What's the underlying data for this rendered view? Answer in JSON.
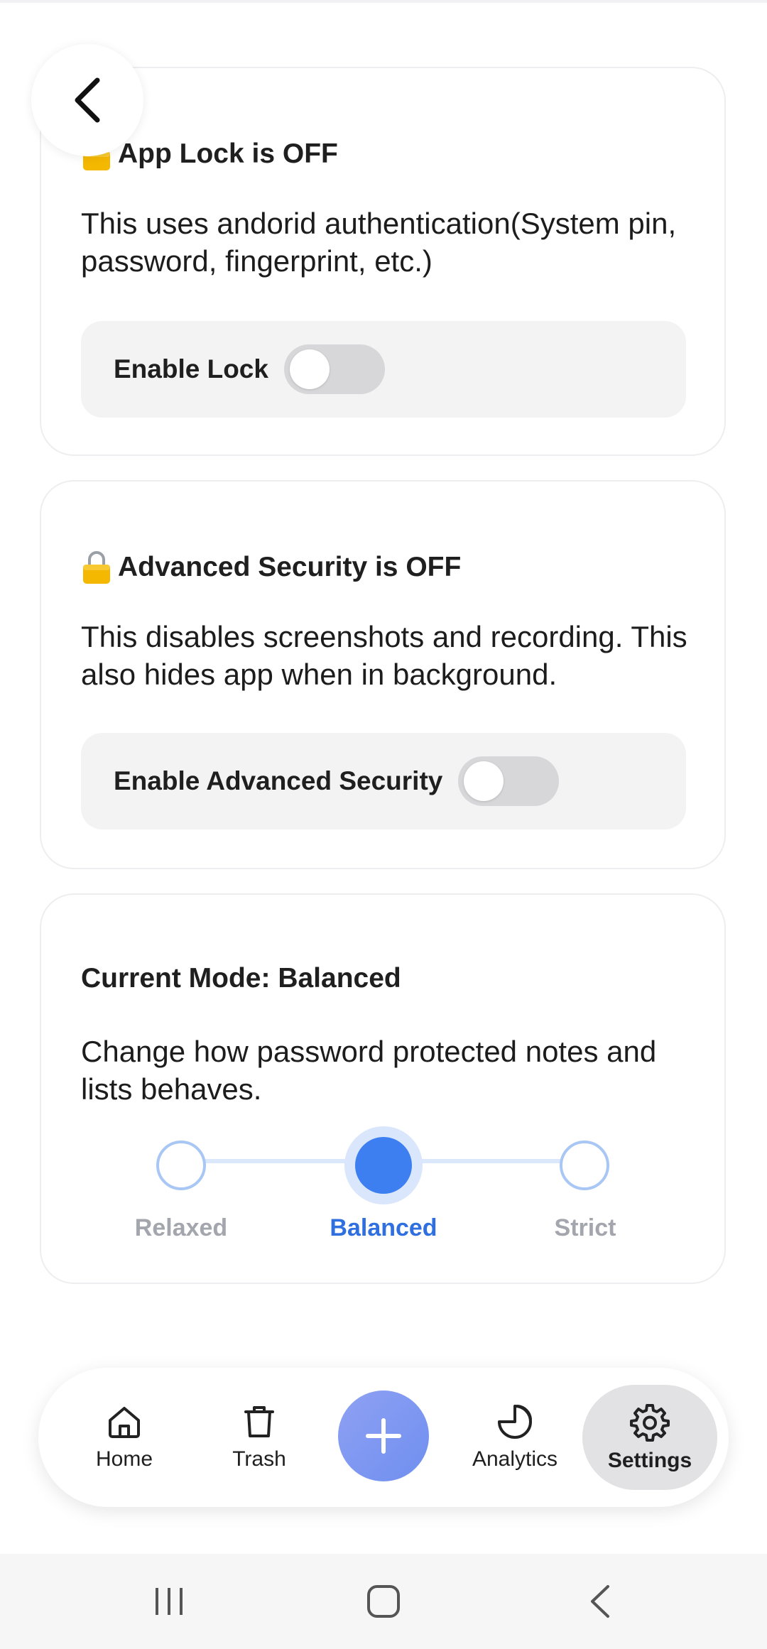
{
  "cards": {
    "app_lock": {
      "title": "App Lock is OFF",
      "description": "This uses andorid authentication(System pin, password, fingerprint, etc.)",
      "toggle_label": "Enable Lock",
      "toggle_on": false,
      "icon": "lock-icon"
    },
    "advanced_security": {
      "title": "Advanced Security is OFF",
      "description": "This disables screenshots and recording. This also hides app when in background.",
      "toggle_label": "Enable Advanced Security",
      "toggle_on": false,
      "icon": "lock-icon"
    },
    "mode": {
      "title": "Current Mode: Balanced",
      "description": "Change how password protected notes and lists behaves.",
      "options": [
        "Relaxed",
        "Balanced",
        "Strict"
      ],
      "selected": "Balanced"
    }
  },
  "nav": {
    "home": "Home",
    "trash": "Trash",
    "analytics": "Analytics",
    "settings": "Settings",
    "active": "Settings"
  },
  "colors": {
    "accent": "#3d7ff0",
    "fab": "#7f98f1",
    "lock_icon": "#f5b800"
  }
}
